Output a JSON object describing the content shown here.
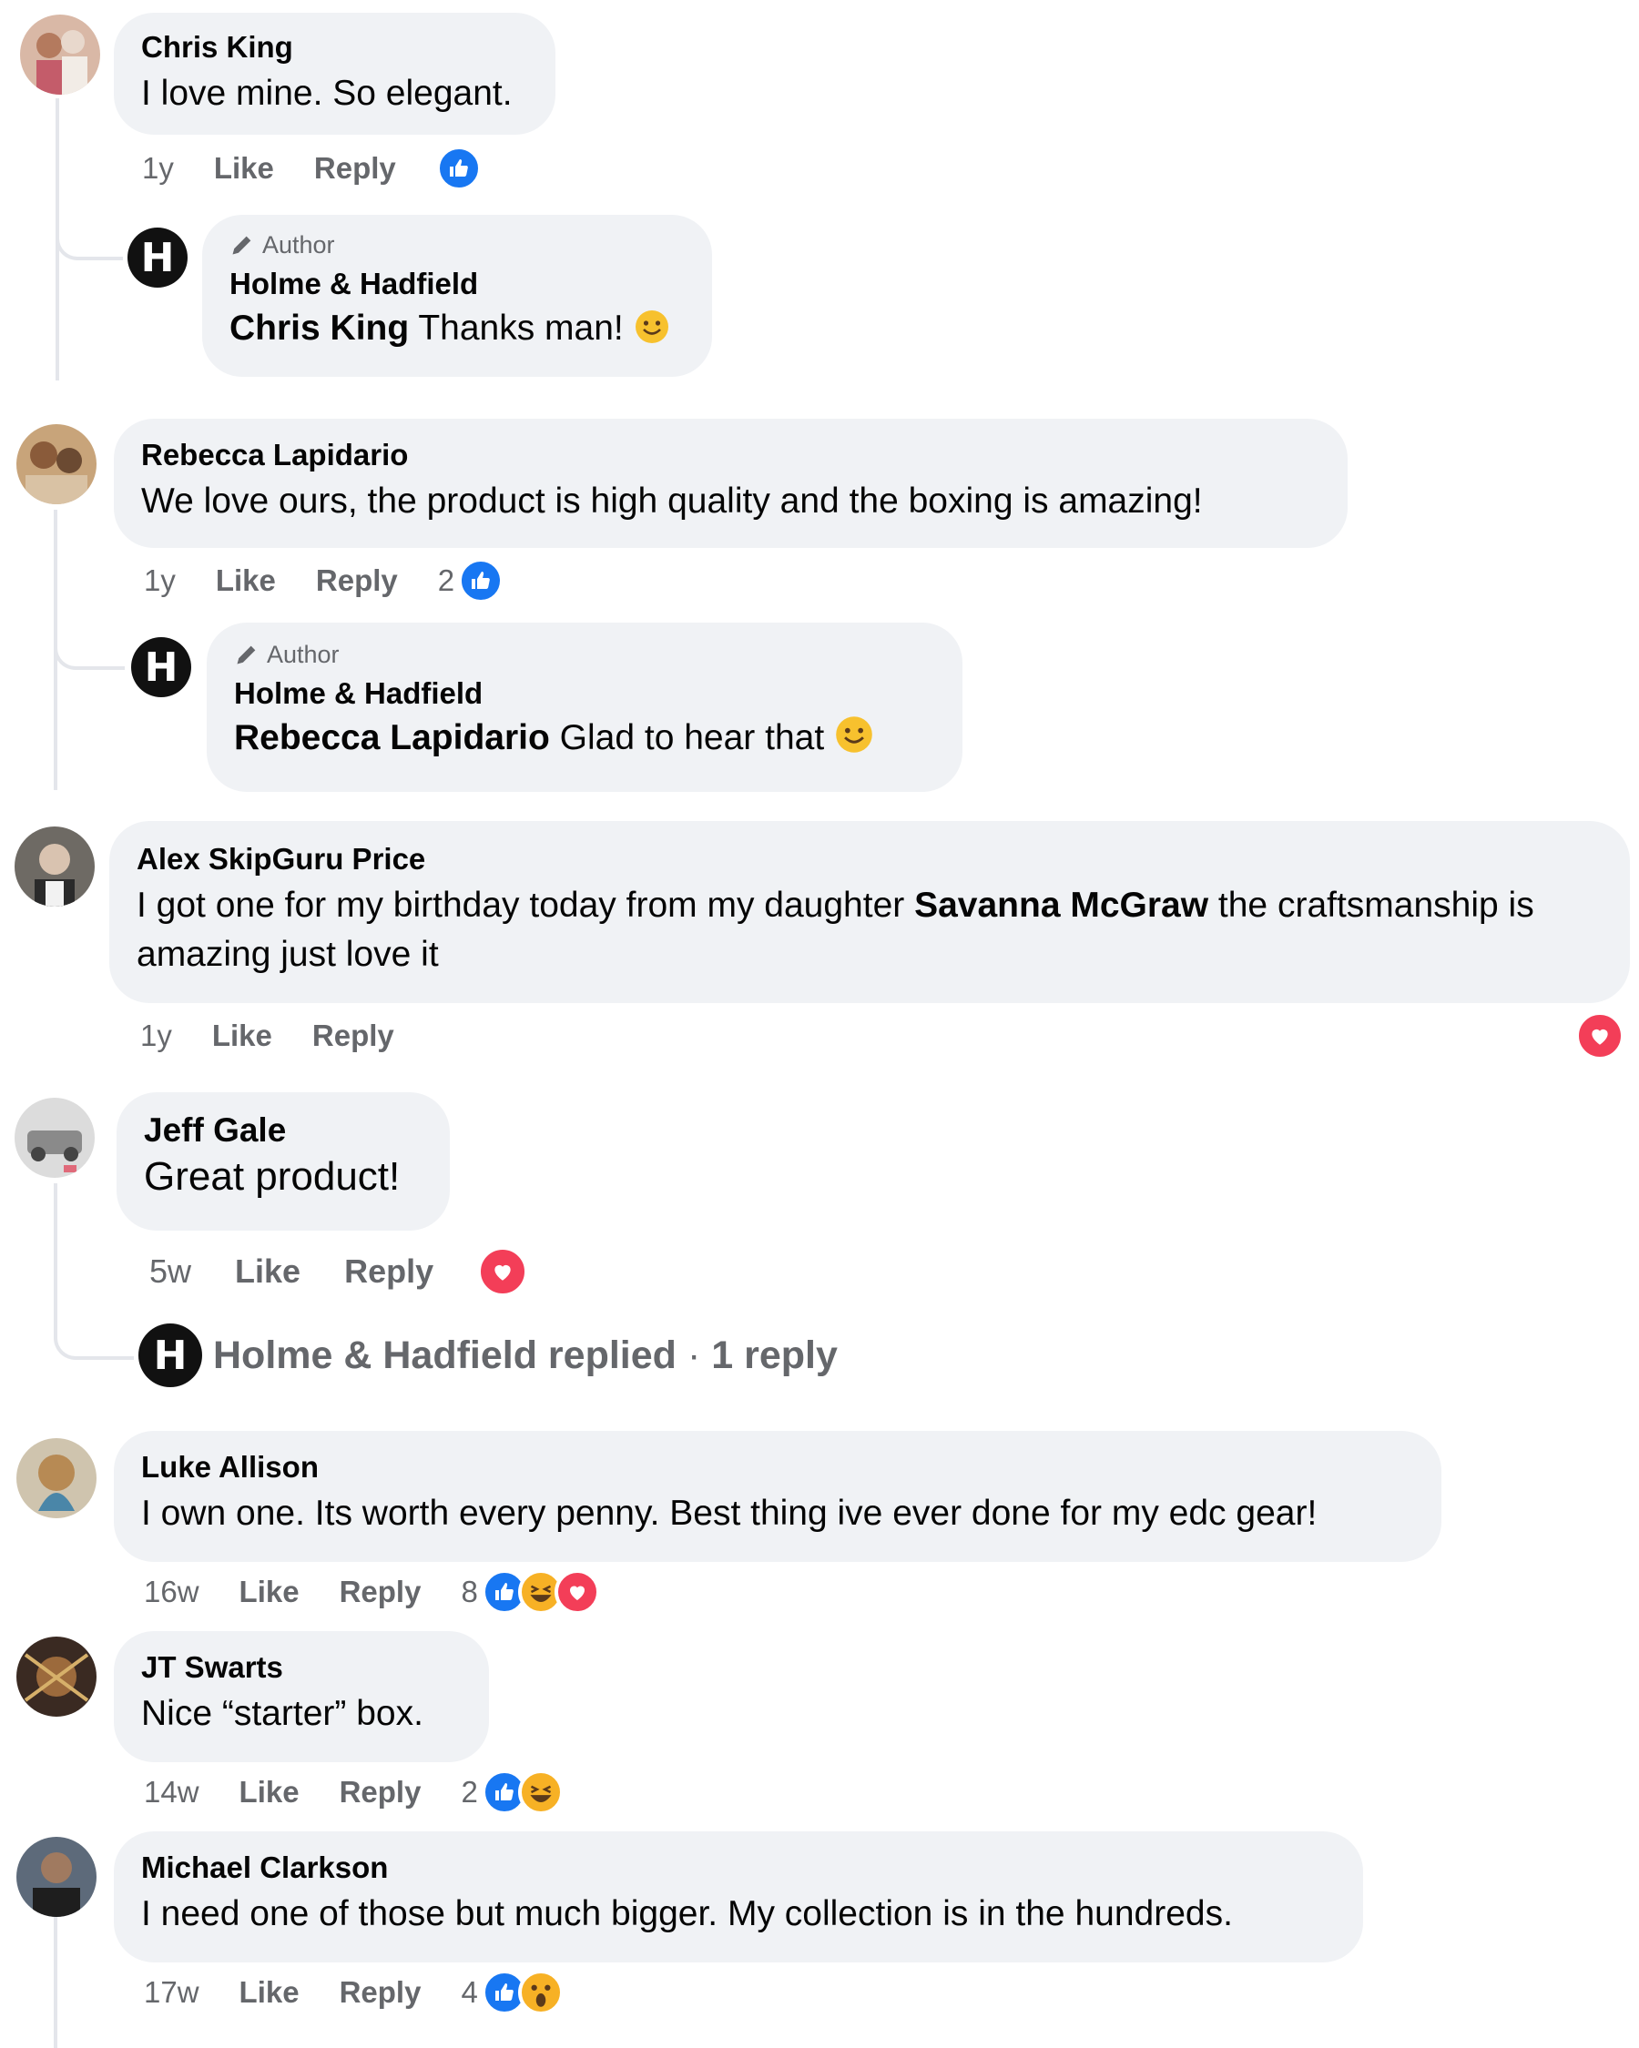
{
  "author_badge": "Author",
  "colors": {
    "bubble": "#f0f2f5",
    "meta": "#65676b",
    "like": "#1877f2",
    "love": "#f33e58",
    "haha": "#f7b125"
  },
  "comments": [
    {
      "name": "Chris King",
      "text": "I love mine. So elegant.",
      "time": "1y",
      "like": "Like",
      "reply": "Reply",
      "reactions": [
        "like"
      ],
      "author_reply": {
        "name": "Holme & Hadfield",
        "tag": "Chris King",
        "text": "Thanks man!",
        "emoji": "smile-emoji"
      }
    },
    {
      "name": "Rebecca Lapidario",
      "text": "We love ours, the product is high quality and the boxing is amazing!",
      "time": "1y",
      "like": "Like",
      "reply": "Reply",
      "reaction_count": "2",
      "reactions": [
        "like"
      ],
      "author_reply": {
        "name": "Holme & Hadfield",
        "tag": "Rebecca Lapidario",
        "text": "Glad to hear that",
        "emoji": "smile-emoji"
      }
    },
    {
      "name": "Alex SkipGuru Price",
      "text_before": "I got one for my birthday today from my daughter",
      "tag": "Savanna McGraw",
      "text_after": "the craftsmanship is amazing just love it",
      "time": "1y",
      "like": "Like",
      "reply": "Reply",
      "reactions": [
        "love"
      ]
    },
    {
      "name": "Jeff Gale",
      "text": "Great product!",
      "time": "5w",
      "like": "Like",
      "reply": "Reply",
      "reactions": [
        "love"
      ],
      "replies_summary": {
        "author": "Holme & Hadfield replied",
        "separator": "·",
        "count": "1 reply"
      }
    },
    {
      "name": "Luke Allison",
      "text": "I own one. Its worth every penny. Best thing ive ever done for my edc gear!",
      "time": "16w",
      "like": "Like",
      "reply": "Reply",
      "reaction_count": "8",
      "reactions": [
        "like",
        "haha",
        "love"
      ]
    },
    {
      "name": "JT Swarts",
      "text": "Nice “starter” box.",
      "time": "14w",
      "like": "Like",
      "reply": "Reply",
      "reaction_count": "2",
      "reactions": [
        "like",
        "haha"
      ]
    },
    {
      "name": "Michael Clarkson",
      "text": "I need one of those but much bigger. My collection is in the hundreds.",
      "time": "17w",
      "like": "Like",
      "reply": "Reply",
      "reaction_count": "4",
      "reactions": [
        "like",
        "wow"
      ]
    }
  ]
}
